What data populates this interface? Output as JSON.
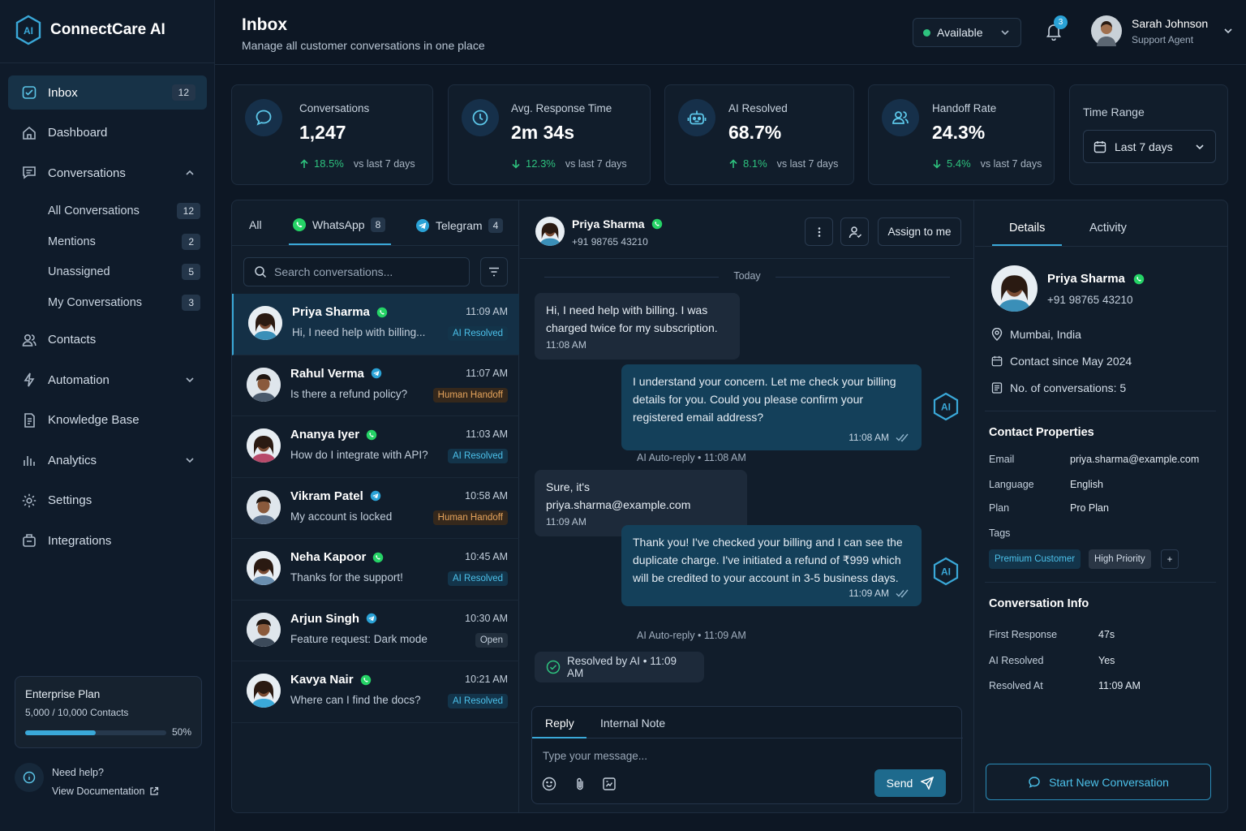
{
  "brand": {
    "name": "ConnectCare AI",
    "logo_text": "AI"
  },
  "nav": {
    "items": [
      {
        "label": "Inbox",
        "badge": "12",
        "icon": "inbox-icon"
      },
      {
        "label": "Dashboard",
        "icon": "home-icon"
      },
      {
        "label": "Conversations",
        "icon": "chat-icon"
      },
      {
        "label": "Contacts",
        "icon": "users-icon"
      },
      {
        "label": "Automation",
        "icon": "automation-icon"
      },
      {
        "label": "Knowledge Base",
        "icon": "book-icon"
      },
      {
        "label": "Analytics",
        "icon": "chart-icon"
      },
      {
        "label": "Settings",
        "icon": "gear-icon"
      },
      {
        "label": "Integrations",
        "icon": "plug-icon"
      }
    ],
    "sub_items": [
      {
        "label": "All Conversations",
        "badge": "12"
      },
      {
        "label": "Mentions",
        "badge": "2"
      },
      {
        "label": "Unassigned",
        "badge": "5"
      },
      {
        "label": "My Conversations",
        "badge": "3"
      }
    ]
  },
  "plan": {
    "title": "Enterprise Plan",
    "contacts": "5,000 / 10,000 Contacts",
    "percent_label": "50%",
    "progress": 0.5
  },
  "help": {
    "title": "Need help?",
    "link": "View Documentation"
  },
  "header": {
    "title": "Inbox",
    "subtitle": "Manage all customer conversations in one place",
    "status": "Available",
    "notification_count": "3",
    "user_name": "Sarah Johnson",
    "user_role": "Support Agent"
  },
  "stats": [
    {
      "label": "Conversations",
      "value": "1,247",
      "change": "18.5%",
      "direction": "up",
      "vs": "vs last 7 days"
    },
    {
      "label": "Avg. Response Time",
      "value": "2m 34s",
      "change": "12.3%",
      "direction": "down",
      "vs": "vs last 7 days"
    },
    {
      "label": "AI Resolved",
      "value": "68.7%",
      "change": "8.1%",
      "direction": "up",
      "vs": "vs last 7 days"
    },
    {
      "label": "Handoff Rate",
      "value": "24.3%",
      "change": "5.4%",
      "direction": "down",
      "vs": "vs last 7 days"
    }
  ],
  "time_range": {
    "label": "Time Range",
    "value": "Last 7 days"
  },
  "list": {
    "tabs": [
      {
        "label": "All"
      },
      {
        "label": "WhatsApp",
        "badge": "8"
      },
      {
        "label": "Telegram",
        "badge": "4"
      }
    ],
    "search_placeholder": "Search conversations...",
    "conversations": [
      {
        "name": "Priya Sharma",
        "channel": "whatsapp",
        "preview": "Hi, I need help with billing...",
        "time": "11:09 AM",
        "status": "AI Resolved"
      },
      {
        "name": "Rahul Verma",
        "channel": "telegram",
        "preview": "Is there a refund policy?",
        "time": "11:07 AM",
        "status": "Human Handoff"
      },
      {
        "name": "Ananya Iyer",
        "channel": "whatsapp",
        "preview": "How do I integrate with API?",
        "time": "11:03 AM",
        "status": "AI Resolved"
      },
      {
        "name": "Vikram Patel",
        "channel": "telegram",
        "preview": "My account is locked",
        "time": "10:58 AM",
        "status": "Human Handoff"
      },
      {
        "name": "Neha Kapoor",
        "channel": "whatsapp",
        "preview": "Thanks for the support!",
        "time": "10:45 AM",
        "status": "AI Resolved"
      },
      {
        "name": "Arjun Singh",
        "channel": "telegram",
        "preview": "Feature request: Dark mode",
        "time": "10:30 AM",
        "status": "Open"
      },
      {
        "name": "Kavya Nair",
        "channel": "whatsapp",
        "preview": "Where can I find the docs?",
        "time": "10:21 AM",
        "status": "AI Resolved"
      }
    ]
  },
  "chat": {
    "name": "Priya Sharma",
    "phone": "+91 98765 43210",
    "assign_label": "Assign to me",
    "day_label": "Today",
    "messages": [
      {
        "text": "Hi, I need help with billing. I was charged twice for my subscription.",
        "time": "11:08 AM"
      },
      {
        "text": "I understand your concern. Let me check your billing details for you. Could you please confirm your registered email address?",
        "time": "11:08 AM",
        "meta": "AI Auto-reply • 11:08 AM"
      },
      {
        "text": "Sure, it's priya.sharma@example.com",
        "time": "11:09 AM"
      },
      {
        "text": "Thank you! I've checked your billing and I can see the duplicate charge. I've initiated a refund of ₹999 which will be credited to your account in 3-5 business days.",
        "time": "11:09 AM",
        "meta": "AI Auto-reply • 11:09 AM"
      }
    ],
    "resolved_label": "Resolved by AI • 11:09 AM",
    "ai_badge": "AI",
    "reply_tab": "Reply",
    "note_tab": "Internal Note",
    "input_placeholder": "Type your message...",
    "send_label": "Send"
  },
  "details": {
    "tab_details": "Details",
    "tab_activity": "Activity",
    "name": "Priya Sharma",
    "phone": "+91 98765 43210",
    "location": "Mumbai, India",
    "contact_since": "Contact since May 2024",
    "conversations": "No. of conversations: 5",
    "props_title": "Contact Properties",
    "props": [
      {
        "k": "Email",
        "v": "priya.sharma@example.com"
      },
      {
        "k": "Language",
        "v": "English"
      },
      {
        "k": "Plan",
        "v": "Pro Plan"
      },
      {
        "k": "Tags",
        "v": ""
      }
    ],
    "tags": [
      "Premium Customer",
      "High Priority"
    ],
    "tag_add": "+",
    "info_title": "Conversation Info",
    "info": [
      {
        "k": "First Response",
        "v": "47s"
      },
      {
        "k": "AI Resolved",
        "v": "Yes"
      },
      {
        "k": "Resolved At",
        "v": "11:09 AM"
      }
    ],
    "start_label": "Start New Conversation"
  },
  "colors": {
    "accent": "#3aa8d8",
    "positive": "#2ec27e",
    "whatsapp": "#25d366",
    "telegram": "#2aa2d6",
    "handoff": "#e6a45c"
  }
}
